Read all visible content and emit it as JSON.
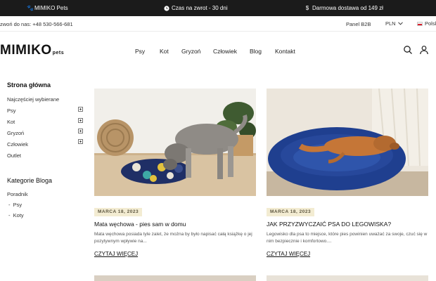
{
  "topbar": {
    "brand": "MIMIKO Pets",
    "returns": "Czas na zwrot - 30 dni",
    "shipping": "Darmowa dostawa od 149 zł"
  },
  "contact": {
    "phone": "zwoń do nas: +48 530-566-681",
    "b2b": "Panel B2B",
    "currency": "PLN",
    "language": "Polsk"
  },
  "header": {
    "logo": "MIMIKO",
    "logo_sub": "pets",
    "nav": [
      "Psy",
      "Kot",
      "Gryzoń",
      "Człowiek",
      "Blog",
      "Kontakt"
    ]
  },
  "sidebar": {
    "title": "Strona główna",
    "items": [
      "Najczęściej wybierane",
      "Psy",
      "Kot",
      "Gryzoń",
      "Człowiek",
      "Outlet"
    ],
    "categories_title": "Kategorie Bloga",
    "categories": [
      "Poradnik",
      "Psy",
      "Koty"
    ]
  },
  "posts": [
    {
      "date": "MARCA 18, 2023",
      "title": "Mata węchowa - pies sam w domu",
      "excerpt": "Mata węchowa posiada tyle zalet, że można by było napisać całą książkę o jej pozytywnym wpływie na...",
      "read_more": "CZYTAJ WIĘCEJ"
    },
    {
      "date": "MARCA 18, 2023",
      "title": "JAK PRZYZWYCZAIĆ PSA DO LEGOWISKA?",
      "excerpt": "Legowisko dla psa to miejsce, które pies powinien uważać za swoje, czuć się w nim bezpiecznie i komfortowo....",
      "read_more": "CZYTAJ WIĘCEJ"
    }
  ],
  "colors": {
    "topbar_bg": "#1b1b1b",
    "badge_bg": "#f3ecd2",
    "bed_blue": "#1f3f8f"
  }
}
